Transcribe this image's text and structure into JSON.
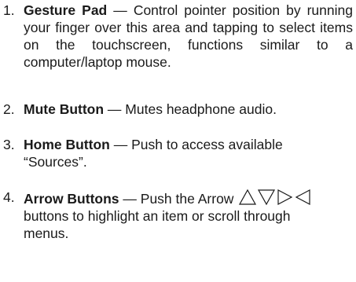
{
  "items": [
    {
      "number": "1.",
      "term": "Gesture Pad",
      "dash": " — ",
      "description": "Control pointer position by running your finger over this area and tapping to select items on the touchscreen, functions similar to a computer/laptop mouse."
    },
    {
      "number": "2.",
      "term": "Mute Button",
      "dash": " — ",
      "description": "Mutes headphone audio."
    },
    {
      "number": "3.",
      "term": "Home Button",
      "dash": " — ",
      "description": "Push to access available “Sources”."
    },
    {
      "number": "4.",
      "term": "Arrow Buttons",
      "dash": " — ",
      "description_before": "Push the Arrow",
      "description_after": "buttons to highlight an item or scroll through menus.",
      "arrow_icons": [
        "up-triangle-icon",
        "down-triangle-icon",
        "right-triangle-icon",
        "left-triangle-icon"
      ]
    }
  ]
}
